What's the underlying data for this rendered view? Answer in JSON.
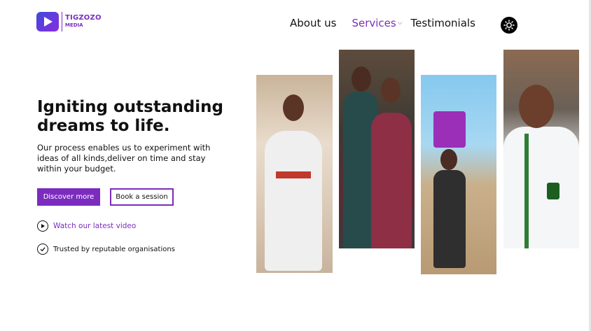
{
  "brand": {
    "name": "TIGZOZO",
    "sub": "MEDIA",
    "accent_color": "#7b2cbf"
  },
  "nav": {
    "items": [
      {
        "label": "About us",
        "active": false
      },
      {
        "label": "Services",
        "active": true,
        "icon": "chevron-down-icon"
      },
      {
        "label": "Testimonials",
        "active": false
      }
    ],
    "theme_toggle_icon": "sun-icon"
  },
  "hero": {
    "title": "Igniting outstanding dreams to life.",
    "description": "Our process enables us to experiment with ideas of all kinds,deliver on time and stay within your budget.",
    "primary_button": "Discover more",
    "secondary_button": "Book a session",
    "watch_link": "Watch our latest video",
    "watch_icon": "play-circle-icon",
    "trusted_text": "Trusted by reputable organisations",
    "trusted_icon": "check-circle-icon"
  },
  "gallery": {
    "photos": [
      {
        "name": "bride-photo"
      },
      {
        "name": "couple-photo"
      },
      {
        "name": "child-with-bucket-photo"
      },
      {
        "name": "student-photo"
      }
    ]
  }
}
